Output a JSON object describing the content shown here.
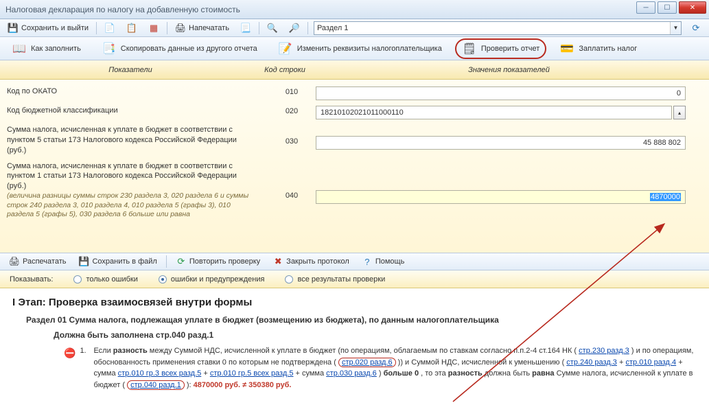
{
  "window": {
    "title": "Налоговая декларация по налогу на добавленную стоимость"
  },
  "tb1": {
    "save_exit": "Сохранить и выйти",
    "print": "Напечатать",
    "section_combo": "Раздел 1"
  },
  "tb2": {
    "how": "Как заполнить",
    "copy": "Скопировать данные из другого отчета",
    "edit_req": "Изменить реквизиты налогоплательщика",
    "check": "Проверить отчет",
    "pay": "Заплатить налог"
  },
  "hdr": {
    "c1": "Показатели",
    "c2": "Код строки",
    "c3": "Значения показателей"
  },
  "rows": {
    "r010": {
      "label": "Код по ОКАТО",
      "code": "010",
      "value": "0"
    },
    "r020": {
      "label": "Код бюджетной классификации",
      "code": "020",
      "value": "18210102021011000110"
    },
    "r030": {
      "label": "Сумма налога, исчисленная к уплате в бюджет в соответствии с пунктом 5 статьи 173 Налогового кодекса Российской Федерации (руб.)",
      "code": "030",
      "value": "45 888 802"
    },
    "r040": {
      "label": "Сумма налога, исчисленная к уплате в бюджет в соответствии с пунктом 1 статьи 173 Налогового кодекса Российской Федерации (руб.)",
      "hint": "(величина разницы суммы строк 230 раздела 3, 020 раздела 6 и суммы строк 240 раздела 3, 010 раздела 4, 010 раздела 5 (графы 3), 010 раздела 5 (графы 5), 030 раздела 6 больше или равна",
      "code": "040",
      "value": "4870000"
    }
  },
  "proto": {
    "print": "Распечатать",
    "save": "Сохранить в файл",
    "repeat": "Повторить проверку",
    "close": "Закрыть протокол",
    "help": "Помощь"
  },
  "filter": {
    "label": "Показывать:",
    "opt1": "только ошибки",
    "opt2": "ошибки и предупреждения",
    "opt3": "все результаты проверки"
  },
  "stage": {
    "title": "I Этап: Проверка взаимосвязей внутри формы",
    "sub1": "Раздел 01 Сумма налога, подлежащая уплате в бюджет (возмещению из бюджета), по данным налогоплательщика",
    "sub2": "Должна быть заполнена стр.040 разд.1",
    "item_num": "1.",
    "item_p1a": "Если ",
    "item_p1b": "разность",
    "item_p1c": " между Суммой НДС, исчисленной к уплате в бюджет (по операциям, облагаемым по ставкам согласно п.п.2-4 ст.164 НК (",
    "link1": "стр.230 разд.3",
    "item_p2a": ") и по операциям, обоснованность применения ставки 0 по которым не подтверждена (",
    "link2": "стр.020 разд.6",
    "item_p2b": ")) и Суммой НДС, исчисленной к уменьшению (",
    "link3": "стр.240 разд.3",
    "plus": " + ",
    "link4": "стр.010 разд.4",
    "item_p3a": " + сумма ",
    "link5": "стр.010 гр.3 всех разд.5",
    "link6": "стр.010 гр.5 всех разд.5",
    "item_p3b": " + сумма ",
    "link7": "стр.030 разд.6",
    "item_p3c": ") ",
    "bold_more": "больше 0",
    "item_p4a": ", то эта ",
    "bold_diff": "разность",
    "item_p4b": " должна быть ",
    "bold_eq": "равна",
    "item_p4c": " Сумме налога, исчисленной к уплате в бюджет (",
    "link8": "стр.040 разд.1",
    "item_p4d": "): ",
    "red": "  4870000 руб. ≠ 350380 руб."
  }
}
